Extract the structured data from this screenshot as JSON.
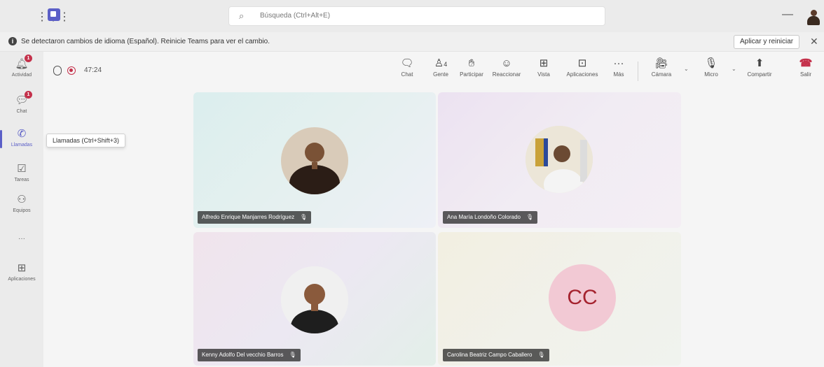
{
  "search": {
    "placeholder": "Búsqueda (Ctrl+Alt+E)"
  },
  "notice": {
    "message": "Se detectaron cambios de idioma (Español). Reinicie Teams para ver el cambio.",
    "apply_label": "Aplicar y reiniciar"
  },
  "rail": {
    "items": [
      {
        "label": "Actividad",
        "icon": "bell-icon",
        "badge": "1"
      },
      {
        "label": "Chat",
        "icon": "chat-icon",
        "badge": "1"
      },
      {
        "label": "Llamadas",
        "icon": "phone-icon",
        "active": true
      },
      {
        "label": "Tareas",
        "icon": "tasks-icon"
      },
      {
        "label": "Equipos",
        "icon": "teams-icon"
      },
      {
        "label": "···",
        "icon": "more-icon"
      },
      {
        "label": "Aplicaciones",
        "icon": "apps-icon"
      }
    ],
    "tooltip": "Llamadas (Ctrl+Shift+3)"
  },
  "call": {
    "timer": "47:24",
    "controls": [
      {
        "label": "Chat",
        "icon": "chat-icon"
      },
      {
        "label": "Gente",
        "icon": "people-icon",
        "count": "4"
      },
      {
        "label": "Participar",
        "icon": "raise-hand-icon"
      },
      {
        "label": "Reaccionar",
        "icon": "smile-icon"
      },
      {
        "label": "Vista",
        "icon": "grid-view-icon"
      },
      {
        "label": "Aplicaciones",
        "icon": "apps-icon"
      },
      {
        "label": "Más",
        "icon": "more-icon"
      },
      {
        "label": "Cámara",
        "icon": "camera-icon"
      },
      {
        "label": "Micro",
        "icon": "mic-icon"
      },
      {
        "label": "Compartir",
        "icon": "share-icon"
      },
      {
        "label": "Salir",
        "icon": "leave-icon"
      }
    ]
  },
  "participants": [
    {
      "name": "Alfredo Enrique Manjarres Rodríguez"
    },
    {
      "name": "Ana María Londoño Colorado"
    },
    {
      "name": "Kenny Adolfo Del vecchio Barros"
    },
    {
      "name": "Carolina Beatriz Campo Caballero",
      "initials": "CC"
    }
  ],
  "colors": {
    "accent": "#5b5fc7",
    "badge": "#c4314b",
    "leave": "#c4314b"
  }
}
